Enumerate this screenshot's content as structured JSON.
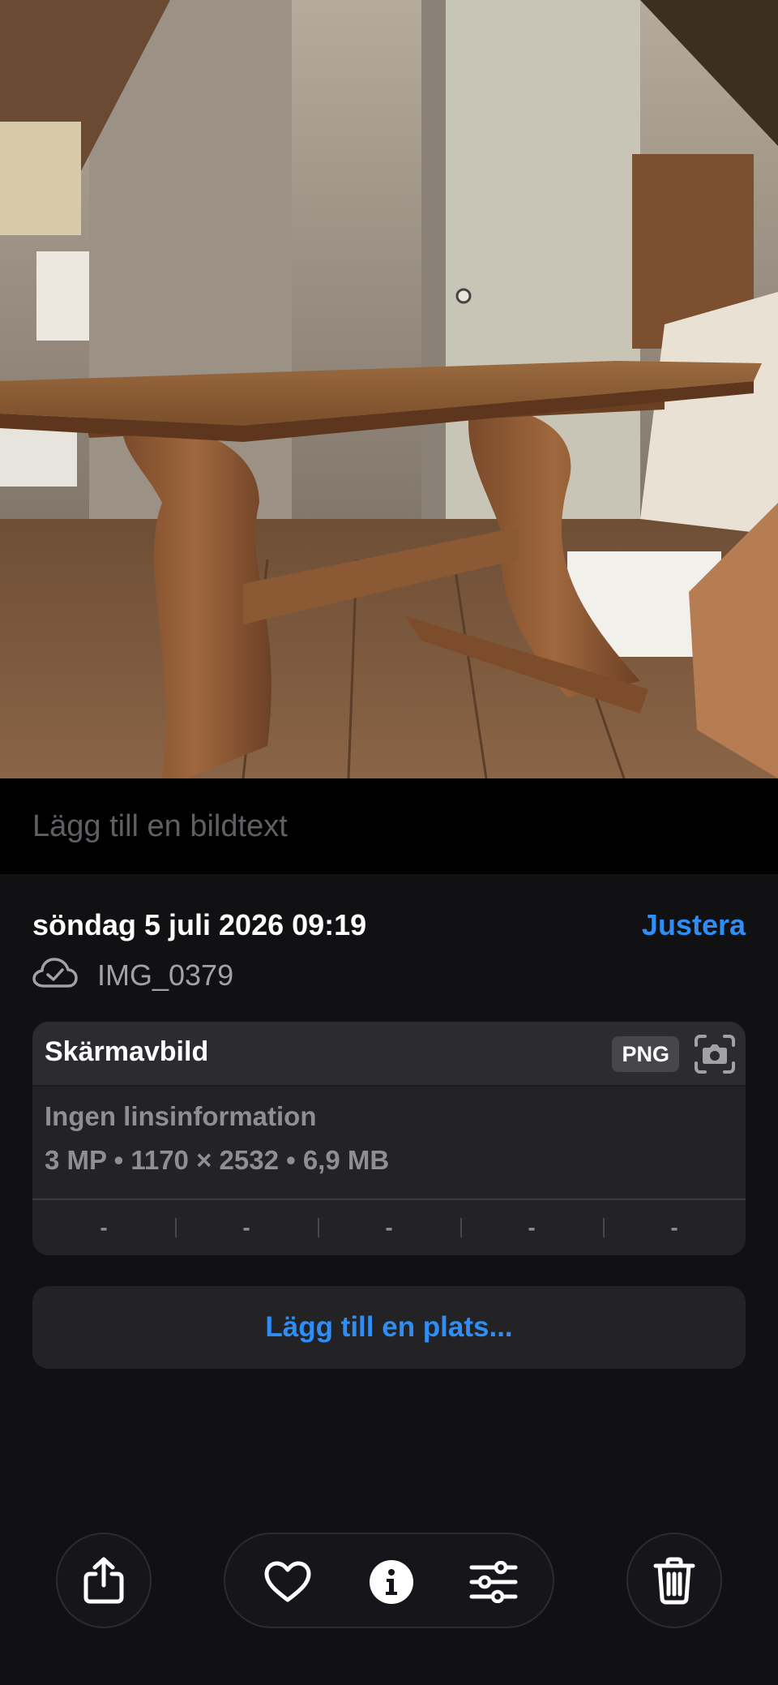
{
  "caption": {
    "placeholder": "Lägg till en bildtext"
  },
  "info": {
    "date_time": "söndag 5 juli 2026 09:19",
    "adjust_label": "Justera",
    "file_name": "IMG_0379",
    "card": {
      "title": "Skärmavbild",
      "format": "PNG",
      "lens_info": "Ingen linsinformation",
      "specs": "3 MP • 1170 × 2532 • 6,9 MB",
      "exif_values": [
        "-",
        "-",
        "-",
        "-",
        "-"
      ]
    },
    "location_button_label": "Lägg till en plats..."
  },
  "toolbar": {
    "icons": [
      "share-icon",
      "heart-icon",
      "info-icon",
      "adjust-sliders-icon",
      "trash-icon"
    ]
  },
  "colors": {
    "accent": "#2f8ef5",
    "background": "#111113",
    "card": "#232326",
    "secondary_text": "#8e8e93"
  }
}
